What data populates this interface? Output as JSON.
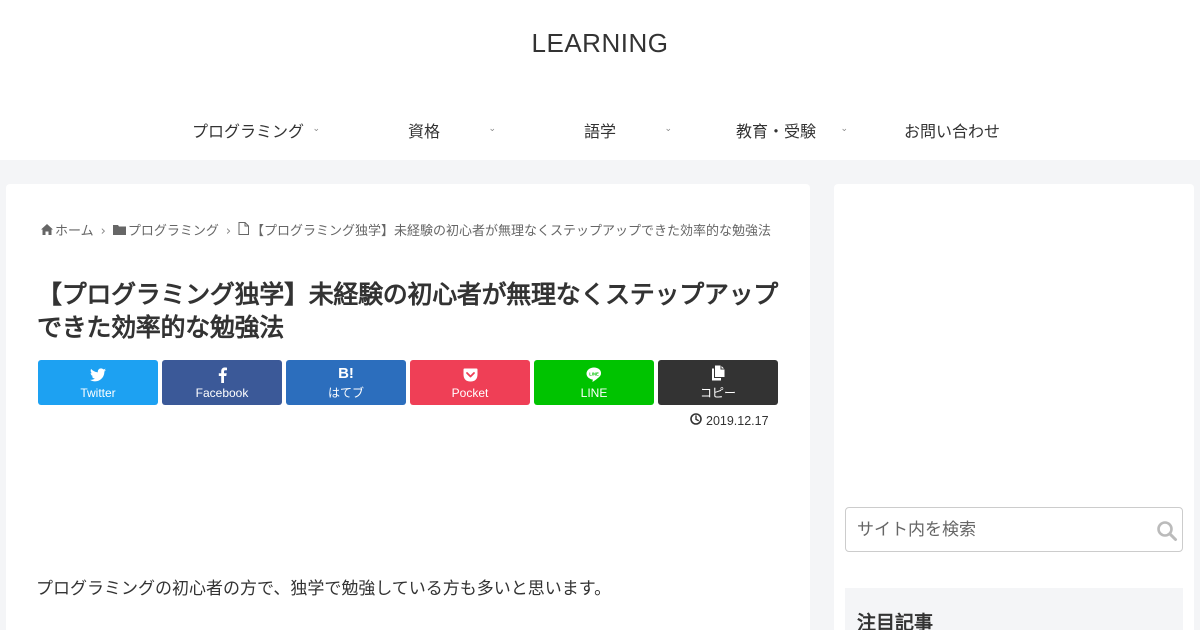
{
  "site": {
    "title": "LEARNING"
  },
  "nav": {
    "items": [
      {
        "label": "プログラミング"
      },
      {
        "label": "資格"
      },
      {
        "label": "語学"
      },
      {
        "label": "教育・受験"
      },
      {
        "label": "お問い合わせ"
      }
    ],
    "chevron": "⌄"
  },
  "breadcrumb": {
    "home": "ホーム",
    "category": "プログラミング",
    "current": "【プログラミング独学】未経験の初心者が無理なくステップアップできた効率的な勉強法",
    "separator": "›"
  },
  "article": {
    "title": "【プログラミング独学】未経験の初心者が無理なくステップアップできた効率的な勉強法",
    "date": "2019.12.17",
    "intro": "プログラミングの初心者の方で、独学で勉強している方も多いと思います。"
  },
  "share": {
    "twitter": {
      "label": "Twitter",
      "color": "#1da1f2"
    },
    "facebook": {
      "label": "Facebook",
      "color": "#3b5998"
    },
    "hatena": {
      "label": "はてブ",
      "icon_text": "B!",
      "color": "#2c6ebd"
    },
    "pocket": {
      "label": "Pocket",
      "color": "#ef3f56"
    },
    "line": {
      "label": "LINE",
      "color": "#00c300"
    },
    "copy": {
      "label": "コピー",
      "color": "#333333"
    }
  },
  "sidebar": {
    "search_placeholder": "サイト内を検索",
    "widget_title": "注目記事"
  }
}
